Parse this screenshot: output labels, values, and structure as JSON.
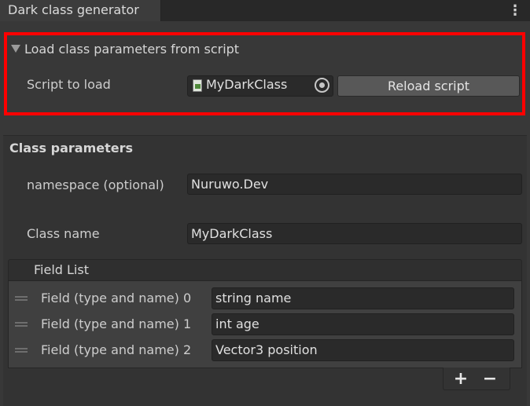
{
  "window": {
    "tab_title": "Dark class generator",
    "more_icon": "kebab-menu-icon"
  },
  "load_section": {
    "foldout_label": "Load class parameters from script",
    "expanded": true,
    "script_label": "Script to load",
    "script_value": "MyDarkClass",
    "script_icon": "csharp-script-icon",
    "picker_icon": "object-picker-icon",
    "reload_button": "Reload script",
    "highlight_color": "#ff0000"
  },
  "params": {
    "header": "Class parameters",
    "namespace_label": "namespace (optional)",
    "namespace_value": "Nuruwo.Dev",
    "class_name_label": "Class name",
    "class_name_value": "MyDarkClass"
  },
  "field_list": {
    "title": "Field List",
    "items": [
      {
        "label": "Field (type and name) 0",
        "value": "string name"
      },
      {
        "label": "Field (type and name) 1",
        "value": "int age"
      },
      {
        "label": "Field (type and name) 2",
        "value": "Vector3 position"
      }
    ],
    "add_label": "+",
    "remove_label": "−"
  }
}
